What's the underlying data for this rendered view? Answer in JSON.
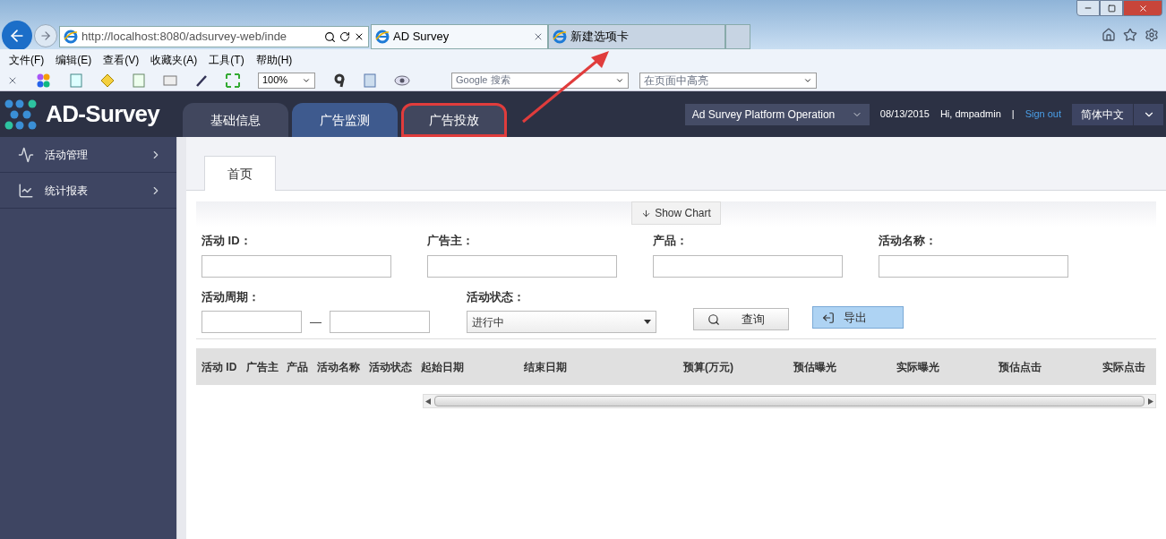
{
  "browser": {
    "address": "http://localhost:8080/adsurvey-web/inde",
    "tabs": [
      {
        "title": "AD Survey",
        "selected": true
      },
      {
        "title": "新建选项卡",
        "selected": false
      }
    ],
    "menu": [
      "文件(F)",
      "编辑(E)",
      "查看(V)",
      "收藏夹(A)",
      "工具(T)",
      "帮助(H)"
    ],
    "zoom": "100%",
    "search_placeholder": "Google 搜索",
    "highlight_placeholder": "在页面中高亮"
  },
  "header": {
    "logo": "AD-Survey",
    "nav_tabs": [
      {
        "label": "基础信息",
        "selected": false,
        "highlighted": false
      },
      {
        "label": "广告监测",
        "selected": true,
        "highlighted": false
      },
      {
        "label": "广告投放",
        "selected": false,
        "highlighted": true
      }
    ],
    "platform": "Ad Survey Platform Operation",
    "date": "08/13/2015",
    "greeting": "Hi, dmpadmin",
    "separator": "|",
    "sign_out": "Sign out",
    "language": "简体中文"
  },
  "sidebar": {
    "items": [
      {
        "label": "活动管理",
        "kind": "activity"
      },
      {
        "label": "统计报表",
        "kind": "chart"
      }
    ]
  },
  "page_tabs": [
    {
      "label": "首页",
      "selected": true
    }
  ],
  "show_chart": "Show Chart",
  "filters": {
    "fields": [
      "活动 ID：",
      "广告主：",
      "产品：",
      "活动名称："
    ],
    "period_label": "活动周期：",
    "period_dash": "—",
    "status_label": "活动状态：",
    "status_value": "进行中",
    "search_button": "查询",
    "export_button": "导出"
  },
  "table": {
    "columns": [
      "活动 ID",
      "广告主",
      "产品",
      "活动名称",
      "活动状态",
      "起始日期",
      "结束日期",
      "预算(万元)",
      "预估曝光",
      "实际曝光",
      "预估点击",
      "实际点击"
    ]
  }
}
